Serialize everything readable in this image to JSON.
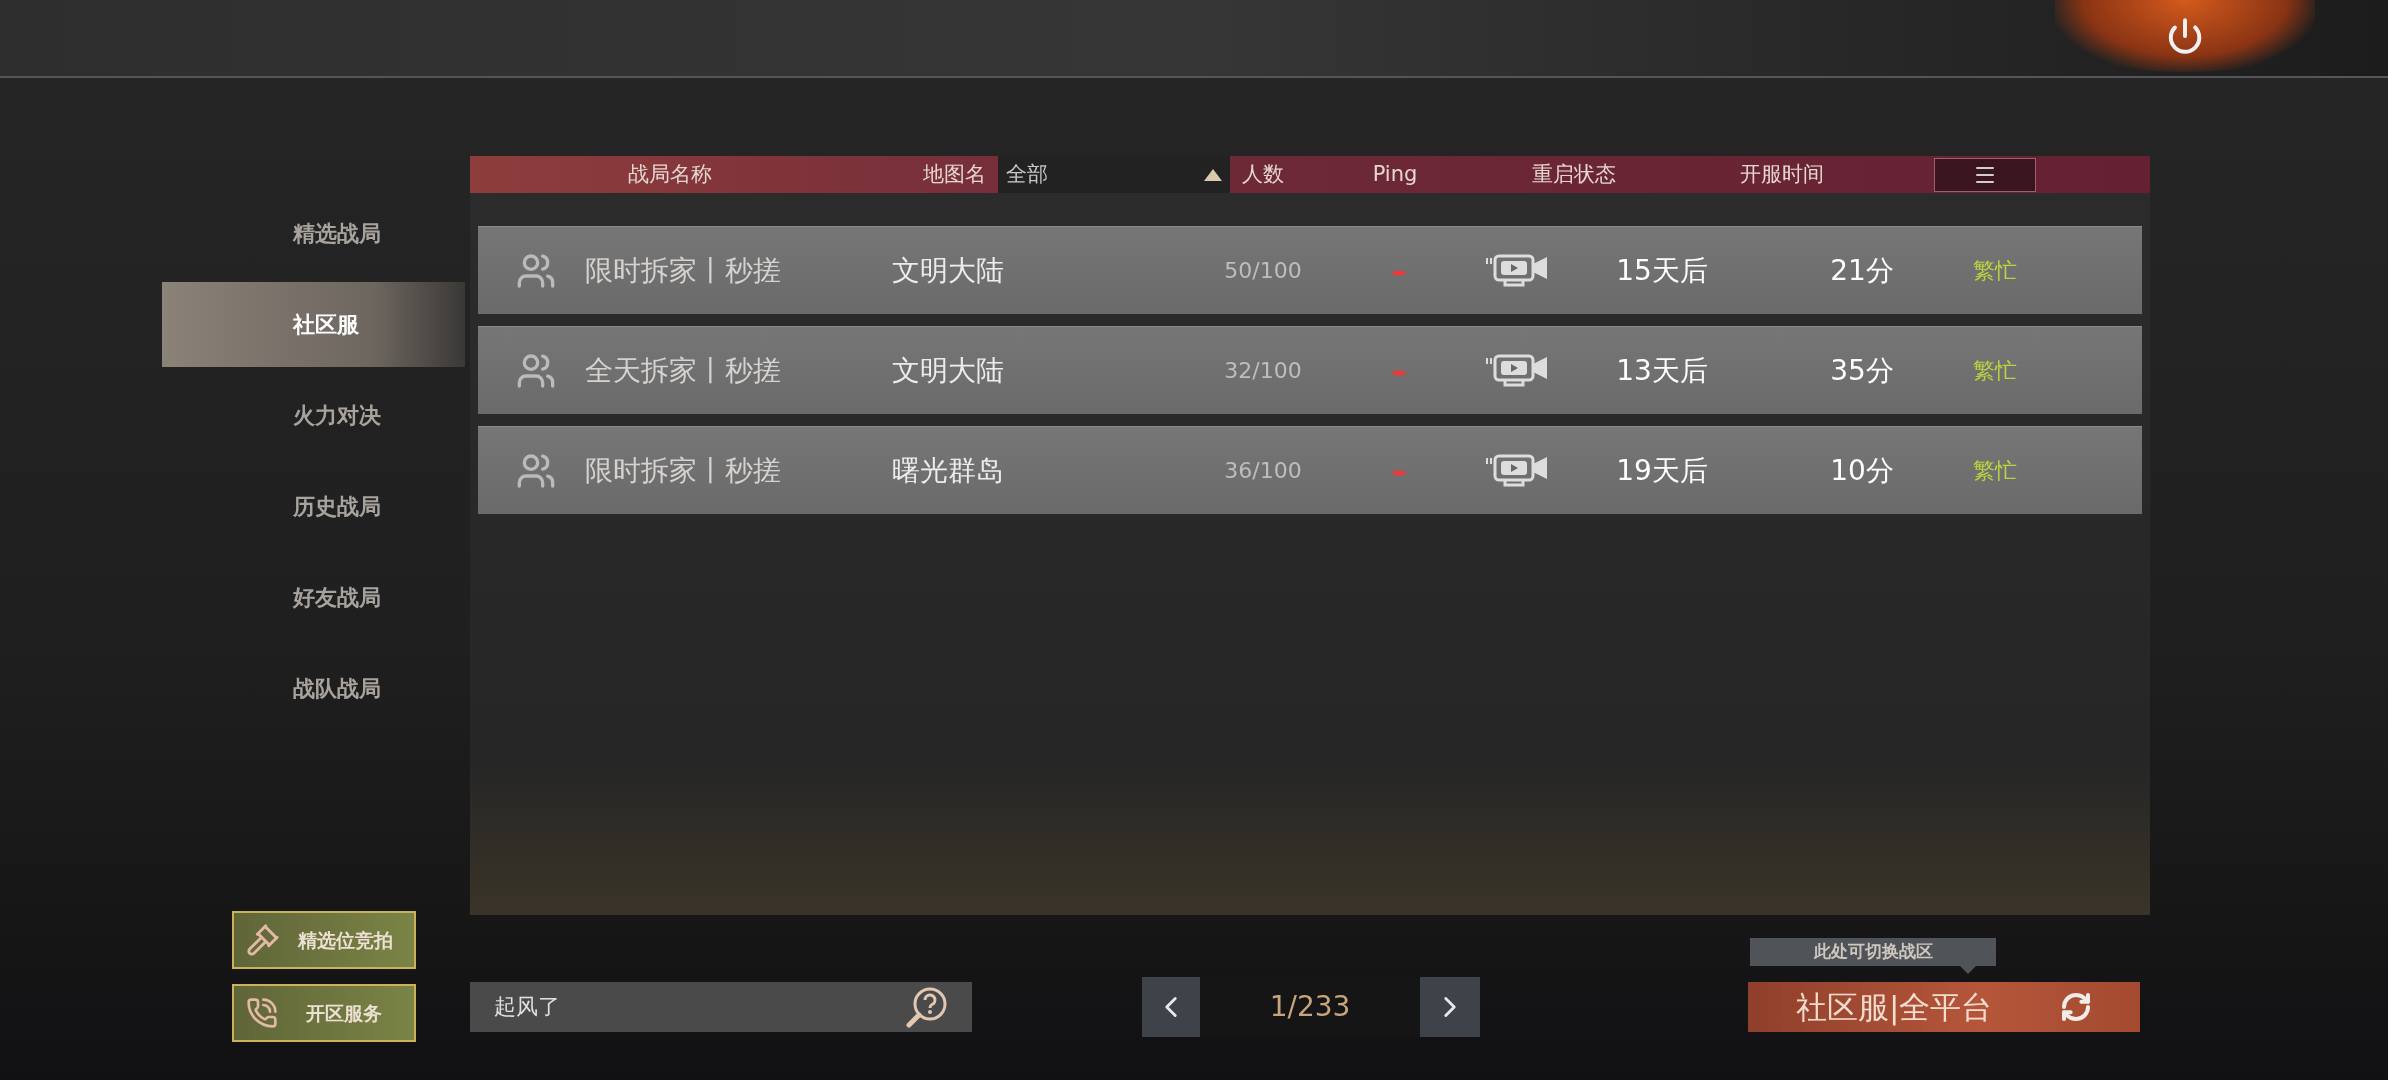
{
  "sidebar": {
    "items": [
      {
        "label": "精选战局",
        "selected": false
      },
      {
        "label": "社区服",
        "selected": true
      },
      {
        "label": "火力对决",
        "selected": false
      },
      {
        "label": "历史战局",
        "selected": false
      },
      {
        "label": "好友战局",
        "selected": false
      },
      {
        "label": "战队战局",
        "selected": false
      }
    ],
    "buttons": [
      {
        "kind": "gavel",
        "label": "精选位竞拍"
      },
      {
        "kind": "phone",
        "label": "开区服务"
      }
    ]
  },
  "table": {
    "columns": [
      {
        "kind": "label",
        "label": "战局名称"
      },
      {
        "kind": "label",
        "label": "地图名"
      },
      {
        "kind": "dropdown",
        "value": "全部"
      },
      {
        "kind": "label",
        "label": "人数"
      },
      {
        "kind": "label",
        "label": "Ping"
      },
      {
        "kind": "label",
        "label": "重启状态"
      },
      {
        "kind": "label",
        "label": "开服时间"
      },
      {
        "kind": "menu"
      }
    ],
    "rows": [
      {
        "name": "限时拆家丨秒搓",
        "map": "文明大陆",
        "players": "50/100",
        "ping": "–",
        "restart": "15天后",
        "uptime": "21分",
        "status": "繁忙",
        "color": "#b8d440"
      },
      {
        "name": "全天拆家丨秒搓",
        "map": "文明大陆",
        "players": "32/100",
        "ping": "–",
        "restart": "13天后",
        "uptime": "35分",
        "status": "繁忙",
        "color": "#b8d440"
      },
      {
        "name": "限时拆家丨秒搓",
        "map": "曙光群岛",
        "players": "36/100",
        "ping": "–",
        "restart": "19天后",
        "uptime": "10分",
        "status": "繁忙",
        "color": "#b8d440"
      }
    ]
  },
  "search": {
    "value": "起风了"
  },
  "pager": {
    "page": "1/233"
  },
  "zone": {
    "tooltip": "此处可切换战区",
    "button": "社区服|全平台"
  }
}
